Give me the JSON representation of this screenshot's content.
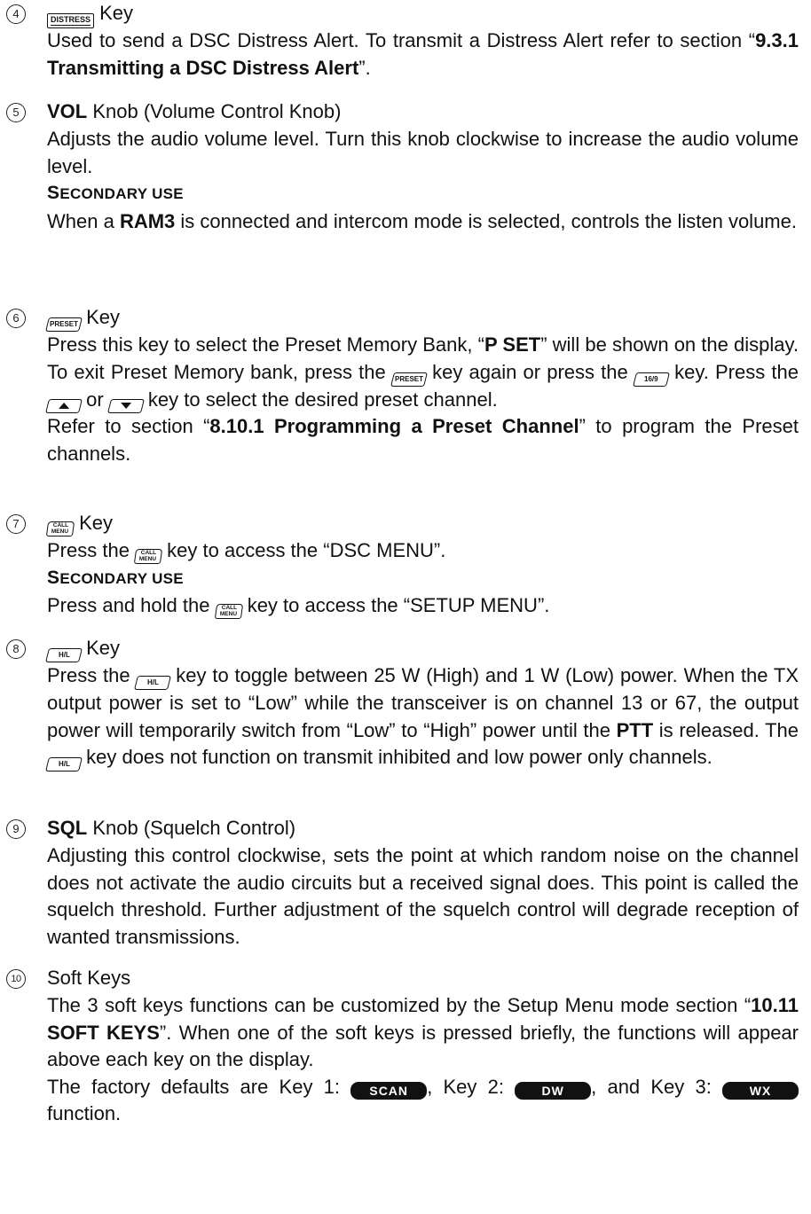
{
  "items": [
    {
      "number": "4",
      "key_label": "DISTRESS",
      "heading_suffix": " Key",
      "p1_a": "Used to send a DSC Distress Alert. To transmit a Distress Alert refer to section “",
      "p1_b": "9.3.1 Transmitting a DSC Distress Alert",
      "p1_c": "”."
    },
    {
      "number": "5",
      "heading_bold": "VOL",
      "heading_rest": " Knob (Volume Control Knob)",
      "p1": "Adjusts the audio volume level. Turn this knob clockwise to increase the audio volume level.",
      "secondary_first": "S",
      "secondary_rest": "ECONDARY USE",
      "p2_a": "When a ",
      "p2_b": "RAM3",
      "p2_c": " is connected and intercom mode is selected, controls the listen volume."
    },
    {
      "number": "6",
      "key_label": "PRESET",
      "heading_suffix": " Key",
      "p1_a": "Press this key to select the Preset Memory Bank, “",
      "p1_b": "P SET",
      "p1_c": "” will be shown on the display. To exit Preset Memory bank, press the ",
      "p1_d": " key again or press the ",
      "key2_label": "16/9",
      "p1_e": " key. Press the ",
      "p1_f": " or ",
      "p1_g": " key to select the desired preset channel.",
      "p2_a": "Refer to section “",
      "p2_b": "8.10.1 Programming a Preset Channel",
      "p2_c": "” to program the Preset channels."
    },
    {
      "number": "7",
      "key_label_top": "CALL",
      "key_label_bottom": "MENU",
      "heading_suffix": " Key",
      "p1_a": "Press the ",
      "p1_b": " key to access the “DSC MENU”.",
      "secondary_first": "S",
      "secondary_rest": "ECONDARY USE",
      "p2_a": "Press and hold the ",
      "p2_b": " key to access the “SETUP MENU”."
    },
    {
      "number": "8",
      "key_label": "H/L",
      "heading_suffix": " Key",
      "p1_a": "Press the ",
      "p1_b": " key to toggle between 25 W (High) and 1 W (Low) power. When the TX output power is set to “Low” while the transceiver is on channel 13 or 67, the output power will temporarily switch from “Low” to “High” power until the ",
      "p1_c": "PTT",
      "p1_d": " is released. The ",
      "p1_e": " key does not function on transmit inhibited and low power only channels."
    },
    {
      "number": "9",
      "heading_bold": "SQL",
      "heading_rest": " Knob (Squelch Control)",
      "p1": "Adjusting this control clockwise, sets the point at which random noise on the channel does not activate the audio circuits but a received signal does. This point is called the squelch threshold. Further adjustment of the squelch control will degrade reception of wanted transmissions."
    },
    {
      "number": "10",
      "heading": "Soft Keys",
      "p1_a": "The 3 soft keys functions can be customized by the Setup Menu mode section “",
      "p1_b": "10.11 SOFT KEYS",
      "p1_c": "”. When one of the soft keys is pressed briefly, the functions will appear above each key on the display.",
      "p2_a": "The factory defaults are Key 1: ",
      "soft1": "SCAN",
      "p2_b": ", Key 2: ",
      "soft2": "DW",
      "p2_c": ", and Key 3: ",
      "soft3": "WX",
      "p2_d": " function."
    }
  ]
}
